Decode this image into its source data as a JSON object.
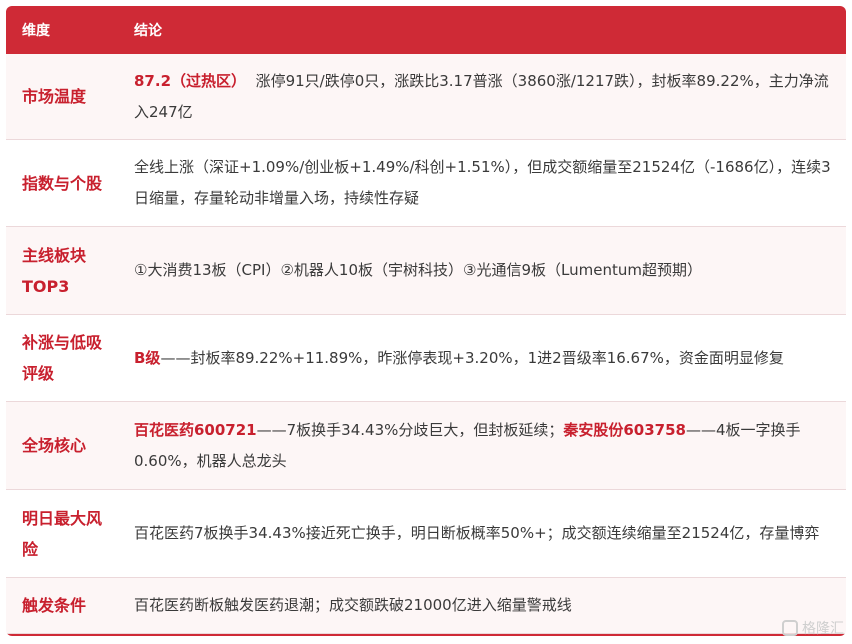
{
  "header": {
    "dimension": "维度",
    "conclusion": "结论"
  },
  "rows": [
    {
      "dimension": "市场温度",
      "hl": "87.2（过热区）",
      "text": "涨停91只/跌停0只，涨跌比3.17普涨（3860涨/1217跌），封板率89.22%，主力净流入247亿"
    },
    {
      "dimension": "指数与个股",
      "text": "全线上涨（深证+1.09%/创业板+1.49%/科创+1.51%），但成交额缩量至21524亿（-1686亿），连续3日缩量，存量轮动非增量入场，持续性存疑"
    },
    {
      "dimension": "主线板块TOP3",
      "text": "①大消费13板（CPI）②机器人10板（宇树科技）③光通信9板（Lumentum超预期）"
    },
    {
      "dimension": "补涨与低吸评级",
      "hl": "B级",
      "text": "——封板率89.22%+11.89%，昨涨停表现+3.20%，1进2晋级率16.67%，资金面明显修复"
    },
    {
      "dimension": "全场核心",
      "hl1": "百花医药600721",
      "text1": "——7板换手34.43%分歧巨大，但封板延续；",
      "hl2": "秦安股份603758",
      "text2": "——4板一字换手0.60%，机器人总龙头"
    },
    {
      "dimension": "明日最大风险",
      "text": "百花医药7板换手34.43%接近死亡换手，明日断板概率50%+；成交额连续缩量至21524亿，存量博弈"
    },
    {
      "dimension": "触发条件",
      "text": "百花医药断板触发医药退潮；成交额跌破21000亿进入缩量警戒线"
    }
  ],
  "watermark": {
    "text": "格隆汇",
    "icon": "logo-icon"
  },
  "colors": {
    "accent": "#cf2a36",
    "highlight_text": "#c8202e",
    "row_alt": "#fdf6f6"
  }
}
